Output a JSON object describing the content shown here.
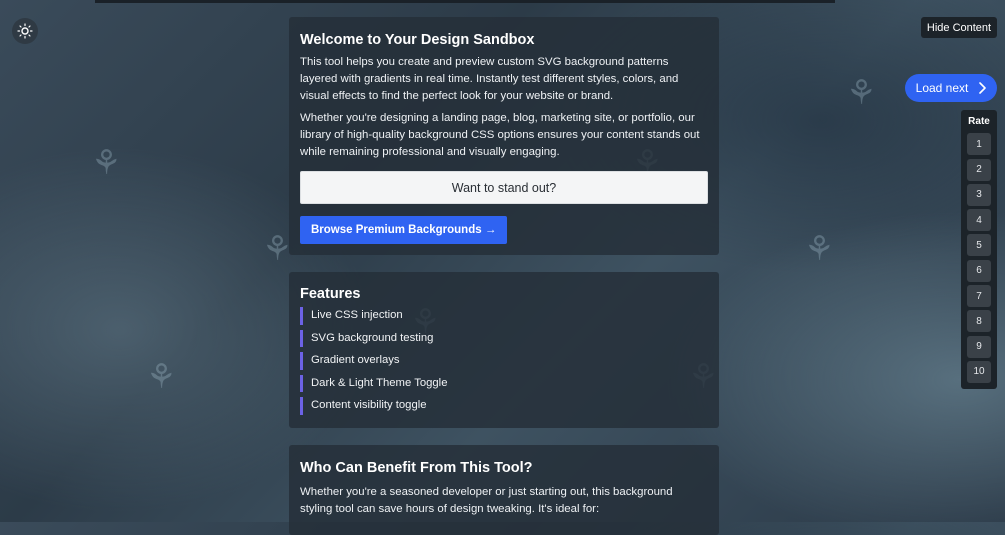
{
  "controls": {
    "hide_content_label": "Hide Content",
    "load_next_label": "Load next",
    "rate_title": "Rate",
    "rate_values": [
      "1",
      "2",
      "3",
      "4",
      "5",
      "6",
      "7",
      "8",
      "9",
      "10"
    ]
  },
  "intro": {
    "title": "Welcome to Your Design Sandbox",
    "para1": "This tool helps you create and preview custom SVG background patterns layered with gradients in real time. Instantly test different styles, colors, and visual effects to find the perfect look for your website or brand.",
    "para2": "Whether you're designing a landing page, blog, marketing site, or portfolio, our library of high-quality background CSS options ensures your content stands out while remaining professional and visually engaging.",
    "cta_text": "Want to stand out?",
    "browse_label": "Browse Premium Backgrounds →"
  },
  "features": {
    "title": "Features",
    "items": [
      "Live CSS injection",
      "SVG background testing",
      "Gradient overlays",
      "Dark & Light Theme Toggle",
      "Content visibility toggle"
    ]
  },
  "benefit": {
    "title": "Who Can Benefit From This Tool?",
    "para": "Whether you're a seasoned developer or just starting out, this background styling tool can save hours of design tweaking. It's ideal for:"
  },
  "colors": {
    "accent_blue": "#2f63f2",
    "feature_bar": "#6c62e6",
    "panel_dark": "#1c2329"
  },
  "icons": {
    "theme_toggle": "sun-icon",
    "load_next": "chevron-right-icon",
    "pattern": "plant-motif-icon"
  }
}
